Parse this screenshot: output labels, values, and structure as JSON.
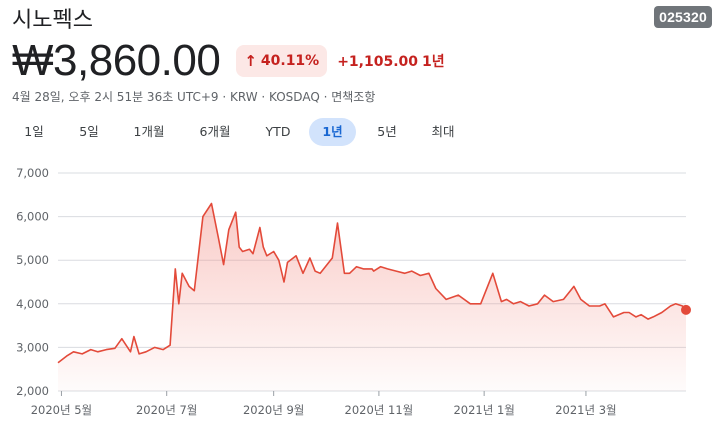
{
  "stock": {
    "name": "시노펙스",
    "ticker": "025320",
    "price": "₩3,860.00",
    "change_pct": "40.11%",
    "change_arrow": "↑",
    "change_abs": "+1,105.00",
    "change_period": "1년",
    "meta": "4월 28일, 오후 2시 51분 36초 UTC+9 · KRW · KOSDAQ · 면책조항"
  },
  "range_tabs": [
    "1일",
    "5일",
    "1개월",
    "6개월",
    "YTD",
    "1년",
    "5년",
    "최대"
  ],
  "active_range": "1년",
  "colors": {
    "line": "#e34a3a",
    "fill_top": "#f28b82",
    "grid": "#dadce0",
    "badge_bg": "#fce8e6",
    "down": "#c5221f"
  },
  "chart_data": {
    "type": "area",
    "y_ticks": [
      "7,000",
      "6,000",
      "5,000",
      "4,000",
      "3,000",
      "2,000"
    ],
    "x_ticks": [
      "2020년 5월",
      "2020년 7월",
      "2020년 9월",
      "2020년 11월",
      "2021년 1월",
      "2021년 3월"
    ],
    "ylim": [
      2000,
      7000
    ],
    "grid": true,
    "series": [
      {
        "x": [
          "2020-04-29",
          "2020-05-04",
          "2020-05-08",
          "2020-05-13",
          "2020-05-18",
          "2020-05-22",
          "2020-05-27",
          "2020-06-01",
          "2020-06-05",
          "2020-06-10",
          "2020-06-12",
          "2020-06-15",
          "2020-06-19",
          "2020-06-24",
          "2020-06-29",
          "2020-07-03",
          "2020-07-06",
          "2020-07-08",
          "2020-07-10",
          "2020-07-14",
          "2020-07-17",
          "2020-07-22",
          "2020-07-27",
          "2020-07-31",
          "2020-08-03",
          "2020-08-06",
          "2020-08-10",
          "2020-08-12",
          "2020-08-14",
          "2020-08-18",
          "2020-08-20",
          "2020-08-24",
          "2020-08-26",
          "2020-08-28",
          "2020-09-01",
          "2020-09-04",
          "2020-09-07",
          "2020-09-09",
          "2020-09-14",
          "2020-09-18",
          "2020-09-22",
          "2020-09-25",
          "2020-09-28",
          "2020-10-05",
          "2020-10-08",
          "2020-10-12",
          "2020-10-15",
          "2020-10-19",
          "2020-10-23",
          "2020-10-28",
          "2020-10-29",
          "2020-11-02",
          "2020-11-06",
          "2020-11-11",
          "2020-11-16",
          "2020-11-20",
          "2020-11-25",
          "2020-11-30",
          "2020-12-04",
          "2020-12-10",
          "2020-12-17",
          "2020-12-24",
          "2020-12-30",
          "2021-01-06",
          "2021-01-11",
          "2021-01-14",
          "2021-01-18",
          "2021-01-22",
          "2021-01-27",
          "2021-02-01",
          "2021-02-05",
          "2021-02-10",
          "2021-02-16",
          "2021-02-22",
          "2021-02-26",
          "2021-03-03",
          "2021-03-09",
          "2021-03-12",
          "2021-03-17",
          "2021-03-23",
          "2021-03-26",
          "2021-03-30",
          "2021-04-02",
          "2021-04-06",
          "2021-04-09",
          "2021-04-14",
          "2021-04-19",
          "2021-04-22",
          "2021-04-26",
          "2021-04-28"
        ],
        "values": [
          2650,
          2800,
          2900,
          2850,
          2950,
          2900,
          2950,
          2980,
          3200,
          2900,
          3250,
          2850,
          2900,
          3000,
          2950,
          3050,
          4800,
          4000,
          4700,
          4400,
          4300,
          6000,
          6300,
          5500,
          4900,
          5700,
          6100,
          5300,
          5200,
          5250,
          5150,
          5750,
          5300,
          5100,
          5200,
          5000,
          4500,
          4950,
          5100,
          4700,
          5050,
          4750,
          4700,
          5050,
          5850,
          4700,
          4700,
          4850,
          4800,
          4800,
          4750,
          4850,
          4800,
          4750,
          4700,
          4750,
          4650,
          4700,
          4350,
          4100,
          4200,
          4000,
          4000,
          4700,
          4050,
          4100,
          4000,
          4050,
          3950,
          4000,
          4200,
          4050,
          4100,
          4400,
          4100,
          3950,
          3950,
          4000,
          3700,
          3800,
          3800,
          3700,
          3750,
          3650,
          3700,
          3800,
          3950,
          4000,
          3950,
          3860
        ]
      }
    ]
  }
}
